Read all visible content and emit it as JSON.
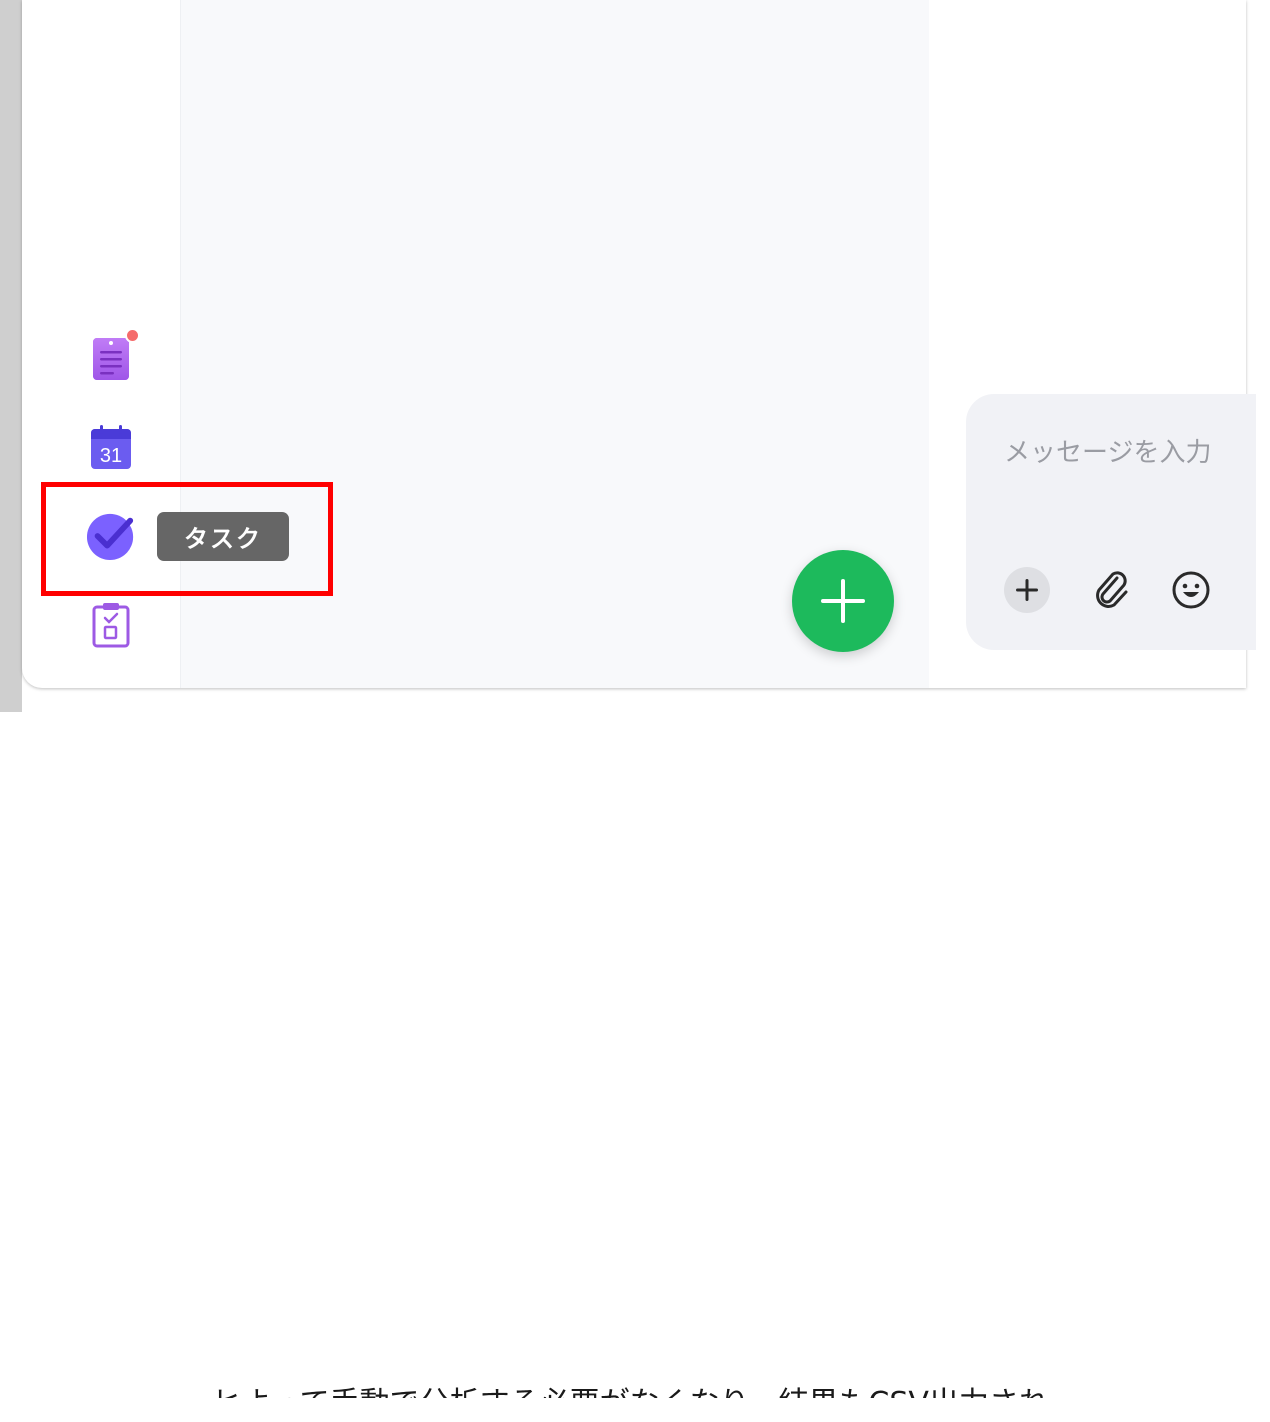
{
  "page": {
    "background_text": "ヒよって手動で分析する必要がなくなり、結果もCSV出力され"
  },
  "rail": {
    "items": [
      {
        "name": "notes",
        "icon": "notes-icon",
        "has_badge": true
      },
      {
        "name": "calendar",
        "icon": "calendar-icon",
        "calendar_day": "31"
      },
      {
        "name": "tasks",
        "icon": "check-circle-icon",
        "tooltip": "タスク",
        "highlighted": true
      },
      {
        "name": "clipboard",
        "icon": "clipboard-check-icon"
      }
    ]
  },
  "fab": {
    "icon": "plus-icon",
    "color": "#1dba5c"
  },
  "composer": {
    "placeholder": "メッセージを入力",
    "tools": [
      {
        "icon": "plus-icon"
      },
      {
        "icon": "paperclip-icon"
      },
      {
        "icon": "smile-icon"
      }
    ]
  },
  "colors": {
    "accent_purple": "#7b61ff",
    "highlight_red": "#ff0000",
    "badge_red": "#f56b6b"
  }
}
